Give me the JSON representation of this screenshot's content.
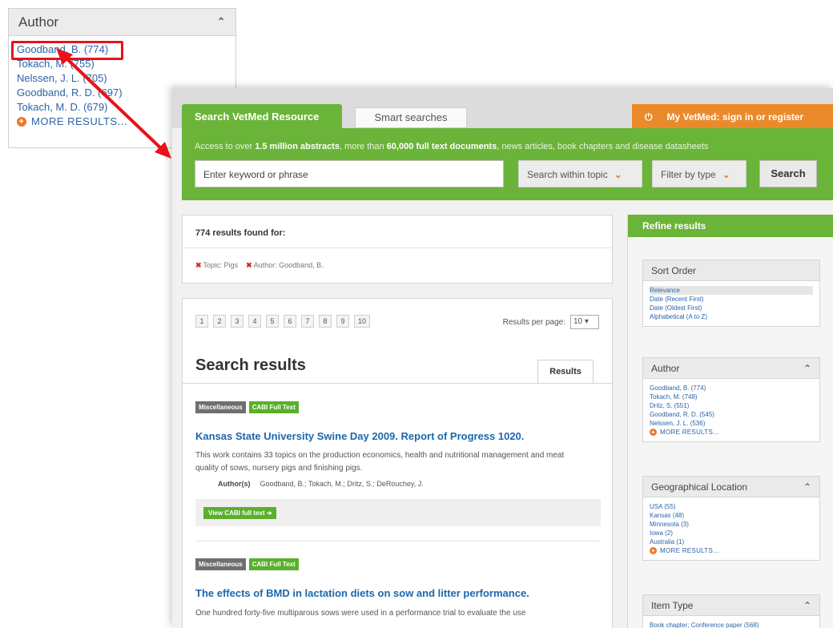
{
  "inset": {
    "title": "Author",
    "items": [
      "Goodband, B. (774)",
      "Tokach, M. (755)",
      "Nelssen, J. L. (705)",
      "Goodband, R. D. (697)",
      "Tokach, M. D. (679)"
    ],
    "more": "MORE RESULTS..."
  },
  "tabs": {
    "active": "Search VetMed Resource",
    "smart": "Smart searches",
    "account": "My VetMed: sign in or register"
  },
  "search": {
    "note_prefix": "Access to over ",
    "note_abstracts": "1.5 million abstracts",
    "note_mid": ", more than ",
    "note_fulltext": "60,000 full text documents",
    "note_suffix": ", news articles, book chapters and disease datasheets",
    "placeholder": "Enter keyword or phrase",
    "topic": "Search within topic",
    "type": "Filter by type",
    "button": "Search"
  },
  "found": {
    "title": "774 results found for:",
    "filters": [
      "Topic: Pigs",
      "Author: Goodband, B."
    ]
  },
  "pagination": {
    "pages": [
      "1",
      "2",
      "3",
      "4",
      "5",
      "6",
      "7",
      "8",
      "9",
      "10"
    ],
    "per_page_label": "Results per page:",
    "per_page_value": "10"
  },
  "results": {
    "heading": "Search results",
    "tab": "Results",
    "items": [
      {
        "badge1": "Miscellaneous",
        "badge2": "CABI Full Text",
        "title": "Kansas State University Swine Day 2009. Report of Progress 1020.",
        "desc": "This work contains 33 topics on the production economics, health and nutritional management and meat quality of sows, nursery pigs and finishing pigs.",
        "authors_label": "Author(s)",
        "authors": "Goodband, B.; Tokach, M.; Dritz, S.; DeRouchey, J.",
        "action": "View CABI full text ➔"
      },
      {
        "badge1": "Miscellaneous",
        "badge2": "CABI Full Text",
        "title": "The effects of BMD in lactation diets on sow and litter performance.",
        "desc": "One hundred forty-five multiparous sows were used in a performance trial to evaluate the use"
      }
    ]
  },
  "refine": {
    "title": "Refine results",
    "sort": {
      "title": "Sort Order",
      "items": [
        "Relevance",
        "Date (Recent First)",
        "Date (Oldest First)",
        "Alphabetical (A to Z)"
      ]
    },
    "author": {
      "title": "Author",
      "items": [
        "Goodband, B. (774)",
        "Tokach, M. (748)",
        "Dritz, S. (551)",
        "Goodband, R. D. (545)",
        "Nelssen, J. L. (536)"
      ],
      "more": "MORE RESULTS..."
    },
    "geo": {
      "title": "Geographical Location",
      "items": [
        "USA (55)",
        "Kansas (48)",
        "Minnesota (3)",
        "Iowa (2)",
        "Australia (1)"
      ],
      "more": "MORE RESULTS..."
    },
    "itemtype": {
      "title": "Item Type",
      "items": [
        "Book chapter; Conference paper (568)"
      ]
    }
  },
  "colors": {
    "brand_green": "#6ab439",
    "accent_orange": "#eb8a2b",
    "link_blue": "#2a63a8",
    "highlight_red": "#e8121a"
  }
}
